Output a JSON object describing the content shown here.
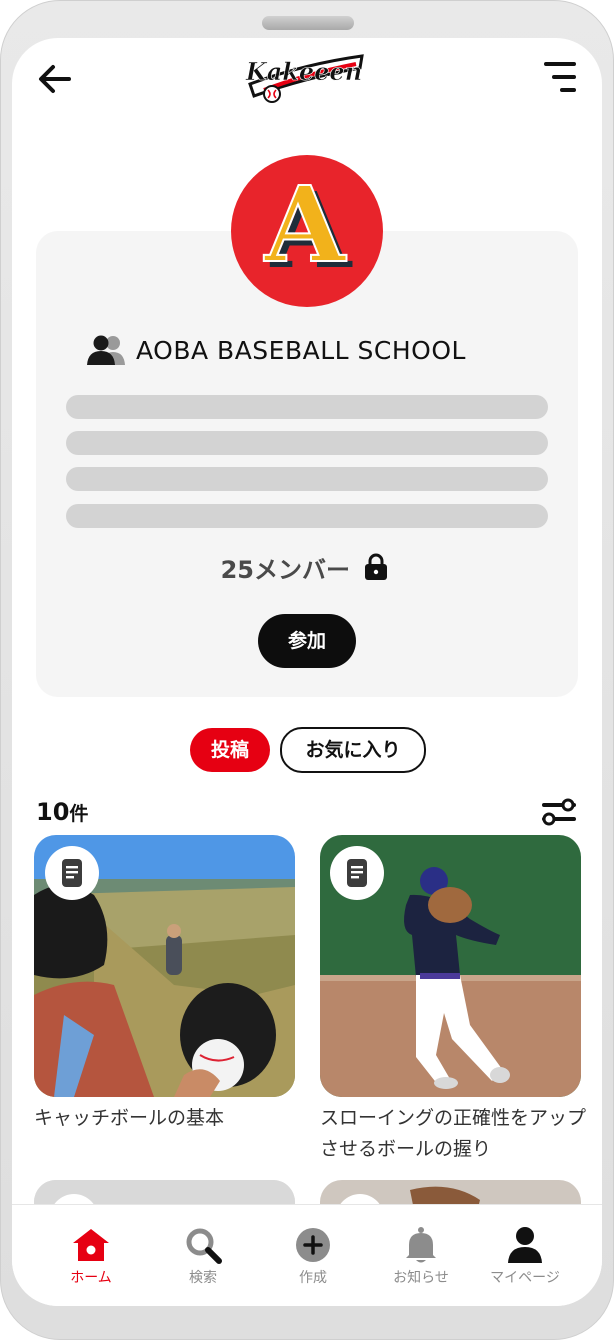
{
  "header": {
    "logo_text": "Kakeeen",
    "back_icon": "arrow-left-icon",
    "menu_icon": "menu-icon"
  },
  "team": {
    "name": "AOBA BASEBALL SCHOOL",
    "emblem_letter": "A",
    "member_count": "25メンバー",
    "join_label": "参加",
    "lock_icon": "lock-icon",
    "colors": {
      "emblem_bg": "#e8242b",
      "emblem_letter": "#f2b21b",
      "emblem_shadow": "#1f2d3a"
    }
  },
  "tabs": {
    "posts": "投稿",
    "favorites": "お気に入り"
  },
  "posts_count": {
    "number": "10",
    "unit": "件"
  },
  "posts": [
    {
      "title": "キャッチボールの基本"
    },
    {
      "title": "スローイングの正確性をアップさせるボールの握り"
    }
  ],
  "bottom_nav": [
    {
      "label": "ホーム",
      "icon": "home-icon",
      "active": true
    },
    {
      "label": "検索",
      "icon": "search-icon",
      "active": false
    },
    {
      "label": "作成",
      "icon": "plus-circle-icon",
      "active": false
    },
    {
      "label": "お知らせ",
      "icon": "bell-icon",
      "active": false
    },
    {
      "label": "マイページ",
      "icon": "person-icon",
      "active": false
    }
  ],
  "colors": {
    "accent": "#e60012",
    "card_bg": "#f5f5f5",
    "placeholder": "#d3d3d3"
  }
}
